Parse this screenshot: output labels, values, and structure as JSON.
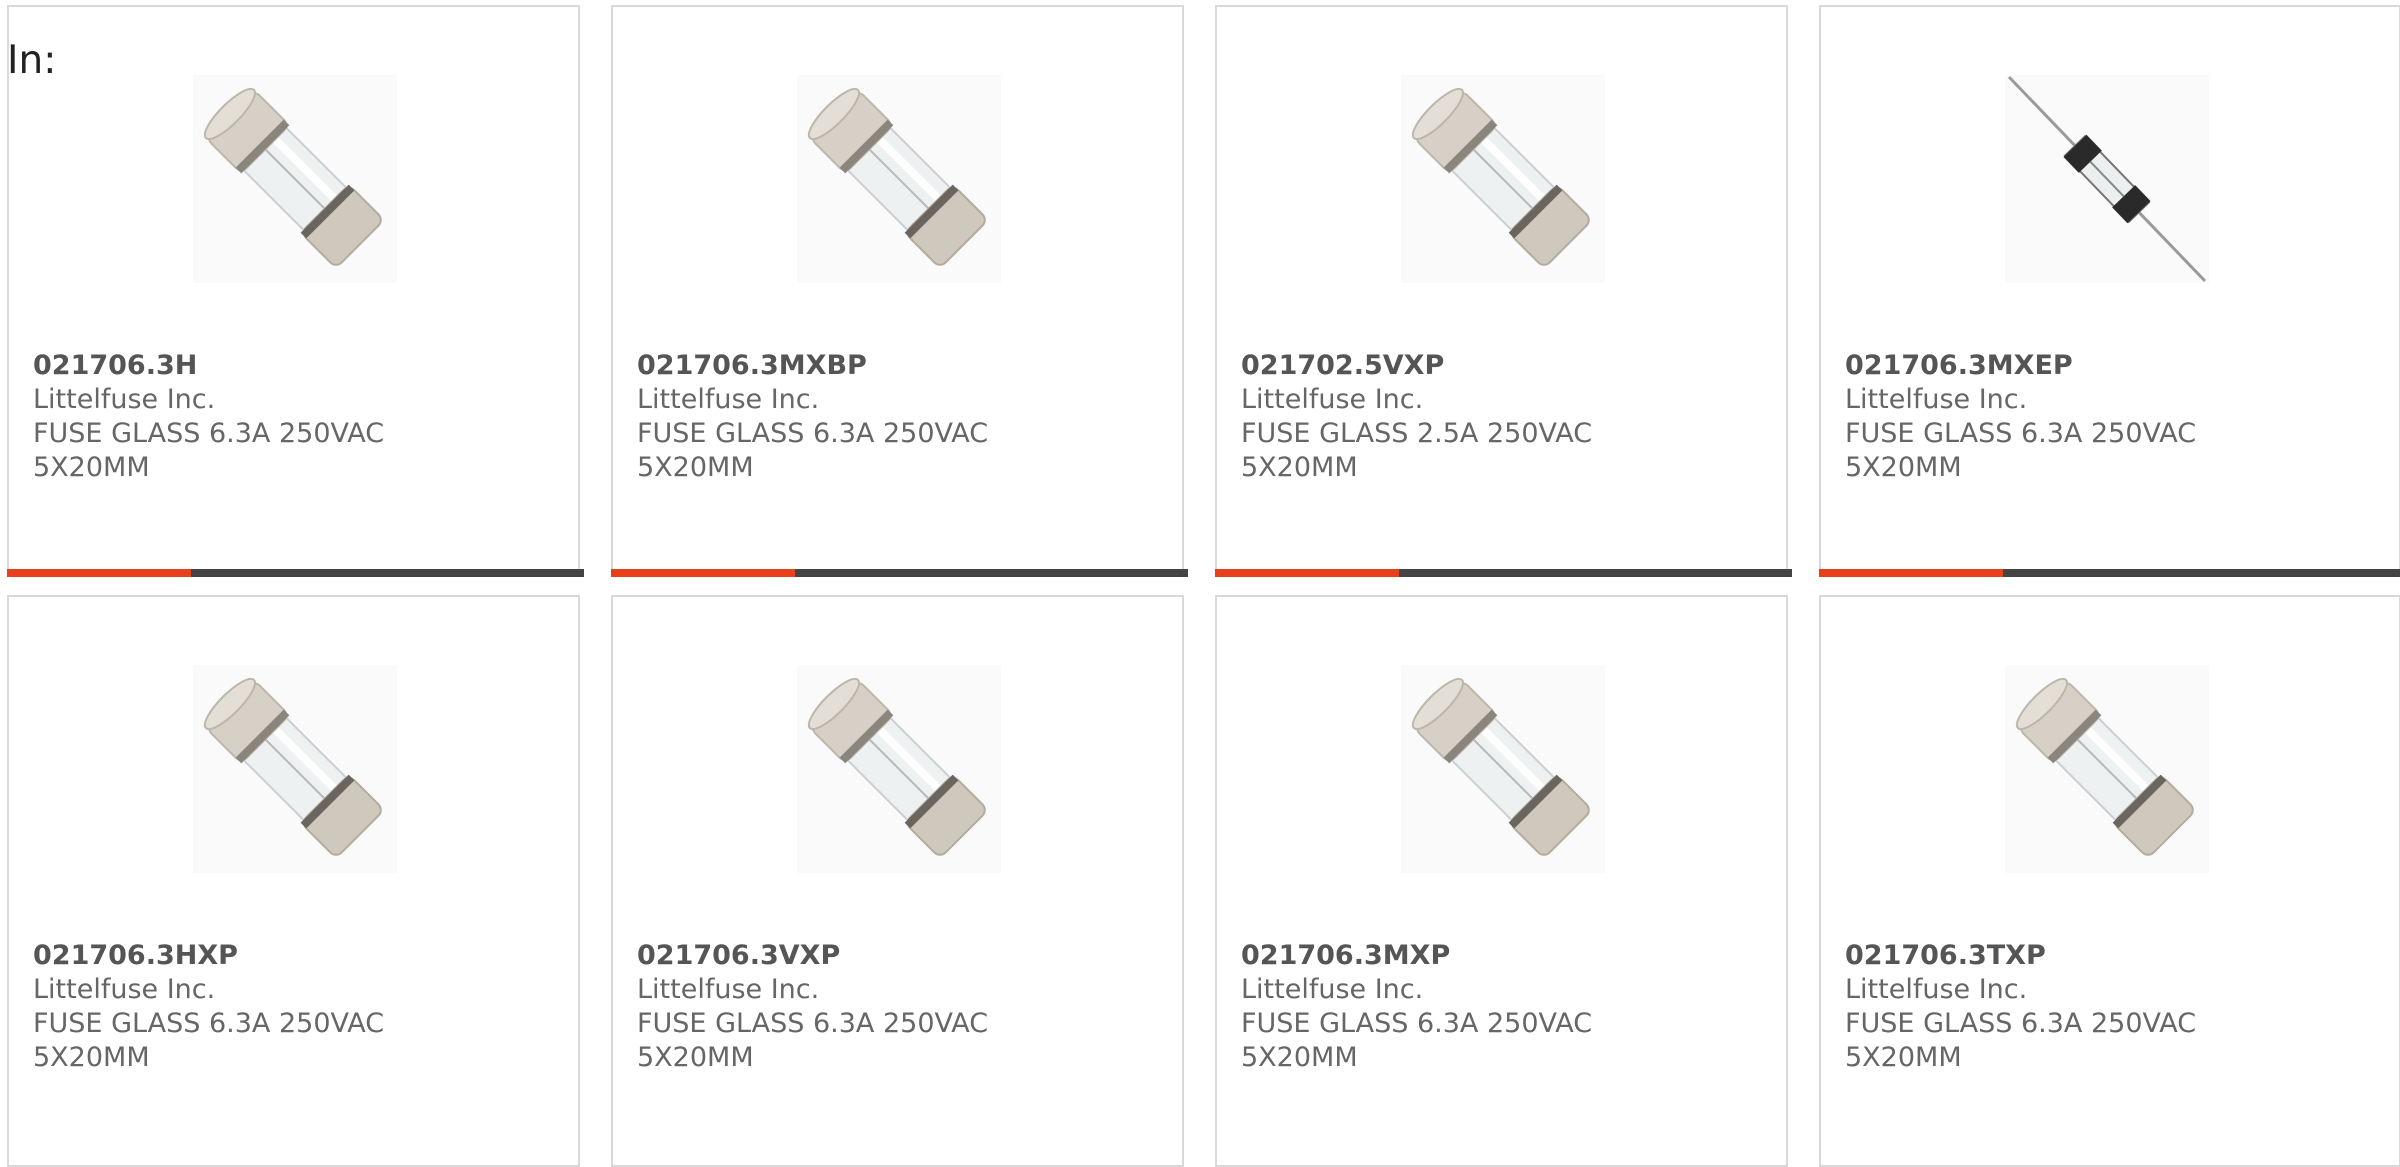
{
  "header": {
    "in_label": "In:"
  },
  "products": [
    {
      "part": "021706.3H",
      "maker": "Littelfuse Inc.",
      "desc": "FUSE GLASS 6.3A 250VAC 5X20MM",
      "image": "glass-fuse-icon"
    },
    {
      "part": "021706.3MXBP",
      "maker": "Littelfuse Inc.",
      "desc": "FUSE GLASS 6.3A 250VAC 5X20MM",
      "image": "glass-fuse-icon"
    },
    {
      "part": "021702.5VXP",
      "maker": "Littelfuse Inc.",
      "desc": "FUSE GLASS 2.5A 250VAC 5X20MM",
      "image": "glass-fuse-icon"
    },
    {
      "part": "021706.3MXEP",
      "maker": "Littelfuse Inc.",
      "desc": "FUSE GLASS 6.3A 250VAC 5X20MM",
      "image": "axial-lead-fuse-icon"
    },
    {
      "part": "021706.3HXP",
      "maker": "Littelfuse Inc.",
      "desc": "FUSE GLASS 6.3A 250VAC 5X20MM",
      "image": "glass-fuse-icon"
    },
    {
      "part": "021706.3VXP",
      "maker": "Littelfuse Inc.",
      "desc": "FUSE GLASS 6.3A 250VAC 5X20MM",
      "image": "glass-fuse-icon"
    },
    {
      "part": "021706.3MXP",
      "maker": "Littelfuse Inc.",
      "desc": "FUSE GLASS 6.3A 250VAC 5X20MM",
      "image": "glass-fuse-icon"
    },
    {
      "part": "021706.3TXP",
      "maker": "Littelfuse Inc.",
      "desc": "FUSE GLASS 6.3A 250VAC 5X20MM",
      "image": "glass-fuse-icon"
    }
  ],
  "colors": {
    "accent": "#e8401c",
    "bar": "#444444",
    "border": "#d9d9d9"
  }
}
